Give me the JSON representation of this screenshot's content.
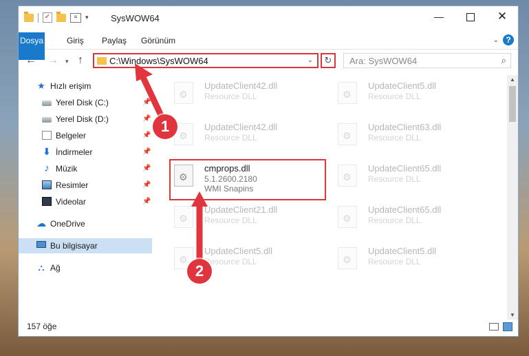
{
  "window": {
    "title": "SysWOW64",
    "minimize": "—",
    "close": "✕"
  },
  "quick_access_toolbar": {
    "check": "✓",
    "props": "≡",
    "caret": "▾"
  },
  "ribbon": {
    "tabs": [
      "Dosya",
      "Giriş",
      "Paylaş",
      "Görünüm"
    ],
    "expand_chevron": "⌄",
    "help": "?"
  },
  "nav": {
    "back": "←",
    "forward": "→",
    "recent": "▾",
    "up": "↑",
    "address": "C:\\Windows\\SysWOW64",
    "address_drop": "⌄",
    "refresh": "↻",
    "search_placeholder": "Ara: SysWOW64",
    "search_icon": "⌕"
  },
  "sidebar": {
    "items": [
      {
        "label": "Hızlı erişim",
        "icon": "star-icon",
        "glyph": "★"
      },
      {
        "label": "Yerel Disk (C:)",
        "icon": "disk-icon",
        "pin": "📌"
      },
      {
        "label": "Yerel Disk (D:)",
        "icon": "disk-icon",
        "pin": "📌"
      },
      {
        "label": "Belgeler",
        "icon": "document-icon",
        "pin": "📌"
      },
      {
        "label": "İndirmeler",
        "icon": "download-icon",
        "glyph": "⬇",
        "pin": "📌"
      },
      {
        "label": "Müzik",
        "icon": "music-icon",
        "glyph": "♪",
        "pin": "📌"
      },
      {
        "label": "Resimler",
        "icon": "pictures-icon",
        "pin": "📌"
      },
      {
        "label": "Videolar",
        "icon": "video-icon",
        "pin": "📌"
      },
      {
        "label": "OneDrive",
        "icon": "cloud-icon",
        "glyph": "☁"
      },
      {
        "label": "Bu bilgisayar",
        "icon": "computer-icon"
      },
      {
        "label": "Ağ",
        "icon": "network-icon",
        "glyph": "⛬"
      }
    ]
  },
  "files": [
    {
      "name": "UpdateClient42.dll",
      "desc": "Resource DLL"
    },
    {
      "name": "UpdateClient5.dll",
      "desc": "Resource DLL"
    },
    {
      "name": "UpdateClient42.dll",
      "desc": "Resource DLL"
    },
    {
      "name": "UpdateClient63.dll",
      "desc": "Resource DLL"
    },
    {
      "name": "cmprops.dll",
      "version": "5.1.2600.2180",
      "desc": "WMI Snapins"
    },
    {
      "name": "UpdateClient65.dll",
      "desc": "Resource DLL"
    },
    {
      "name": "UpdateClient21.dll",
      "desc": "Resource DLL"
    },
    {
      "name": "UpdateClient65.dll",
      "desc": "Resource DLL"
    },
    {
      "name": "UpdateClient5.dll",
      "desc": "Resource DLL"
    },
    {
      "name": "UpdateClient5.dll",
      "desc": "Resource DLL"
    }
  ],
  "scrollbar": {
    "up": "▲",
    "down": "▼"
  },
  "status": {
    "item_count": "157 öğe"
  },
  "annotations": {
    "marker_1": "1",
    "marker_2": "2",
    "color": "#e0353e"
  }
}
